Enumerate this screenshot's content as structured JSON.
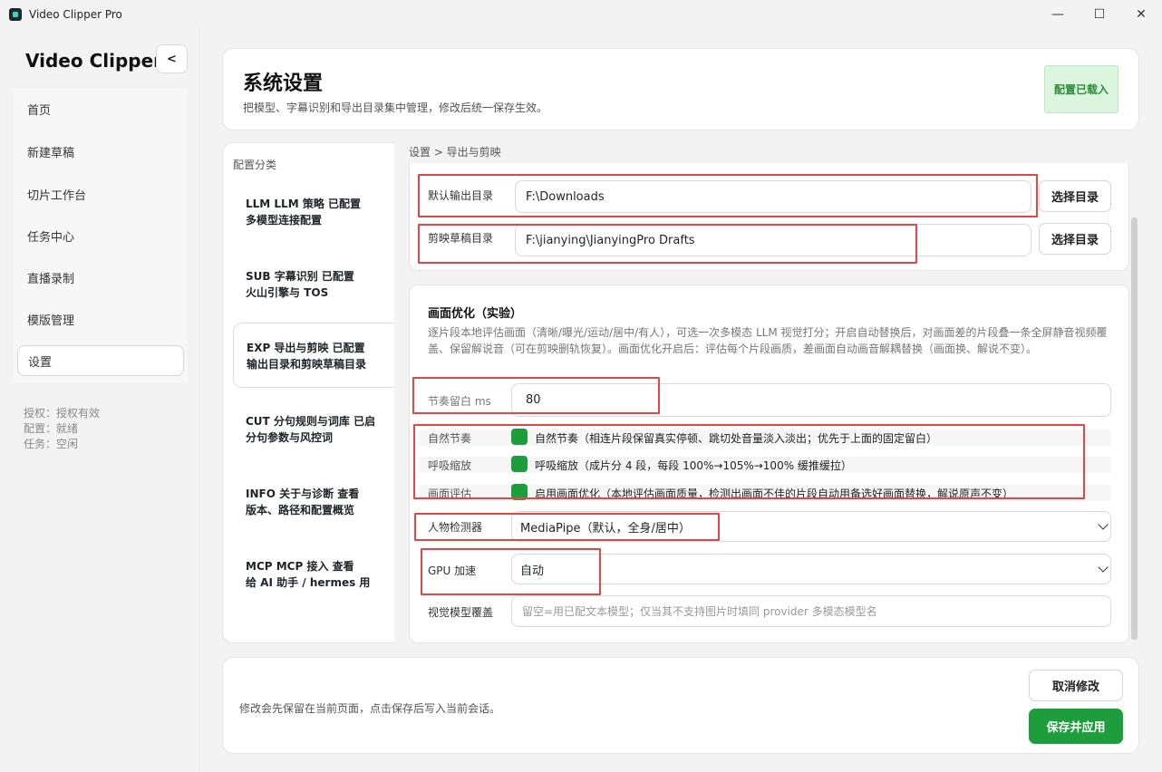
{
  "window": {
    "title": "Video Clipper Pro",
    "controls": [
      "—",
      "☐",
      "✕"
    ]
  },
  "sidebar": {
    "brand": "Video Clipper",
    "collapse_label": "<",
    "items": [
      {
        "label": "首页"
      },
      {
        "label": "新建草稿"
      },
      {
        "label": "切片工作台"
      },
      {
        "label": "任务中心"
      },
      {
        "label": "直播录制"
      },
      {
        "label": "模版管理"
      },
      {
        "label": "设置"
      }
    ],
    "status": [
      "授权：授权有效",
      "配置：就绪",
      "任务：空闲"
    ]
  },
  "header": {
    "title": "系统设置",
    "subtitle": "把模型、字幕识别和导出目录集中管理，修改后统一保存生效。",
    "badge": "配置已载入"
  },
  "categories": {
    "heading": "配置分类",
    "items": [
      {
        "line1": "LLM  LLM 策略    已配置",
        "line2": "多模型连接配置"
      },
      {
        "line1": "SUB  字幕识别    已配置",
        "line2": "火山引擎与 TOS"
      },
      {
        "line1": "EXP  导出与剪映    已配置",
        "line2": "输出目录和剪映草稿目录"
      },
      {
        "line1": "CUT  分句规则与词库    已启",
        "line2": "分句参数与风控词"
      },
      {
        "line1": "INFO  关于与诊断    查看",
        "line2": "版本、路径和配置概览"
      },
      {
        "line1": "MCP  MCP 接入    查看",
        "line2": "给 AI 助手 / hermes 用"
      }
    ]
  },
  "breadcrumb": "设置 > 导出与剪映",
  "export": {
    "output_label": "默认输出目录",
    "output_value": "F:\\Downloads",
    "draft_label": "剪映草稿目录",
    "draft_value": "F:\\jianying\\JianyingPro Drafts",
    "choose_dir": "选择目录"
  },
  "optimize": {
    "title": "画面优化（实验）",
    "description": "逐片段本地评估画面（清晰/曝光/运动/居中/有人），可选一次多模态 LLM 视觉打分；开启自动替换后，对画面差的片段叠一条全屏静音视频覆盖、保留解说音（可在剪映删轨恢复）。画面优化开启后：评估每个片段画质，差画面自动画音解耦替换（画面换、解说不变）。",
    "rhythm_label": "节奏留白 ms",
    "rhythm_value": "80",
    "toggles": [
      {
        "label": "自然节奏",
        "text": "自然节奏（相连片段保留真实停顿、跳切处音量淡入淡出；优先于上面的固定留白）",
        "on": true
      },
      {
        "label": "呼吸缩放",
        "text": "呼吸缩放（成片分 4 段，每段 100%→105%→100% 缓推缓拉）",
        "on": true
      },
      {
        "label": "画面评估",
        "text": "启用画面优化（本地评估画面质量，检测出画面不佳的片段自动用备选好画面替换，解说原声不变）",
        "on": true
      }
    ],
    "detector_label": "人物检测器",
    "detector_value": "MediaPipe（默认，全身/居中）",
    "gpu_label": "GPU 加速",
    "gpu_value": "自动",
    "vision_label": "视觉模型覆盖",
    "vision_placeholder": "留空=用已配文本模型；仅当其不支持图片时填同 provider 多模态模型名"
  },
  "footer": {
    "hint": "修改会先保留在当前页面，点击保存后写入当前会话。",
    "cancel": "取消修改",
    "save": "保存并应用"
  },
  "colors": {
    "primary": "#1e9d3d",
    "badge_bg": "#dcf5de",
    "highlight": "#e04848"
  }
}
